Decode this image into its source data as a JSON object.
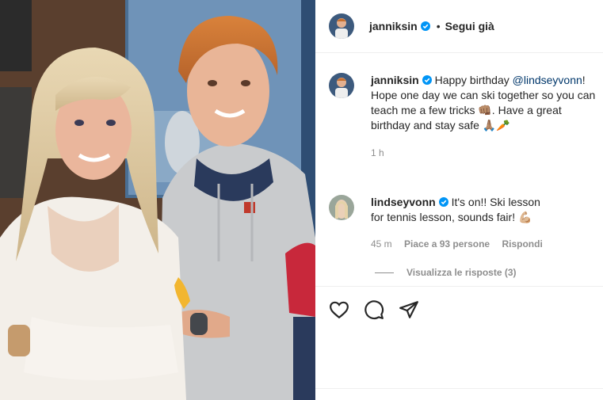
{
  "post": {
    "author": "janniksin",
    "follow_state": "Segui già",
    "separator": "•"
  },
  "caption": {
    "author": "janniksin",
    "text_1": "Happy birthday ",
    "mention": "@lindseyvonn",
    "text_2": "! Hope one day we can ski together so you can teach me a few tricks 👊🏽. Have a great birthday and stay safe 🙏🏽🥕",
    "time": "1 h"
  },
  "reply": {
    "author": "lindseyvonn",
    "text": "It's on!! Ski lesson for tennis lesson, sounds fair! 💪🏼",
    "time": "45 m",
    "likes": "Piace a 93 persone",
    "reply_action": "Rispondi"
  },
  "view_replies": "Visualizza le risposte (3)",
  "icons": {
    "like": "heart-icon",
    "comment": "comment-icon",
    "share": "paper-plane-icon",
    "verified": "verified-badge-icon"
  },
  "colors": {
    "text": "#262626",
    "secondary": "#8e8e8e",
    "link": "#00376b",
    "verified": "#0095f6",
    "divider": "#efefef"
  }
}
